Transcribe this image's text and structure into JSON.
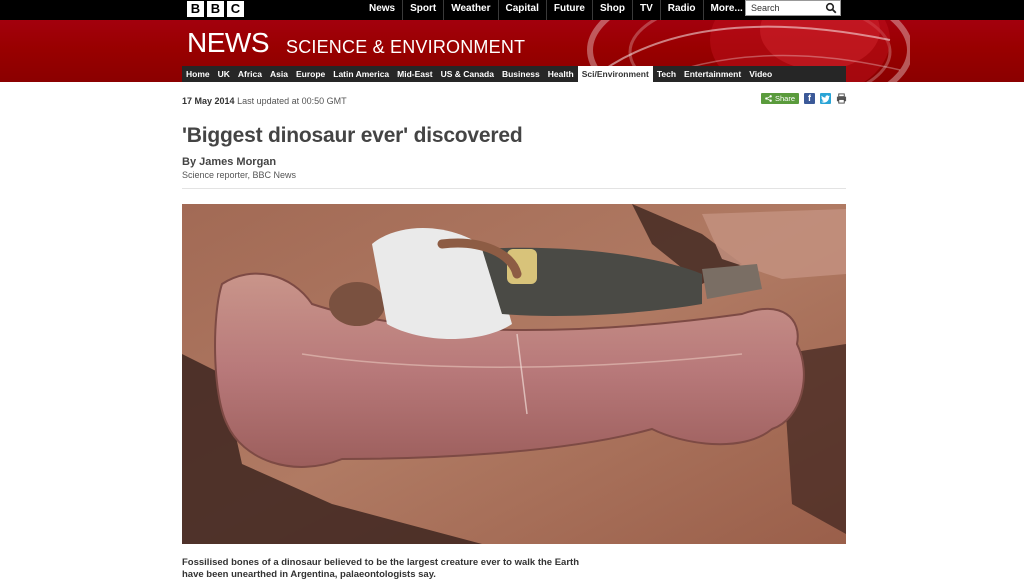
{
  "brand": {
    "logo_letters": [
      "B",
      "B",
      "C"
    ]
  },
  "top_nav": {
    "items": [
      "News",
      "Sport",
      "Weather",
      "Capital",
      "Future",
      "Shop",
      "TV",
      "Radio",
      "More..."
    ],
    "search_placeholder": "Search"
  },
  "banner": {
    "news_label": "NEWS",
    "section_label": "SCIENCE & ENVIRONMENT"
  },
  "section_nav": {
    "items": [
      "Home",
      "UK",
      "Africa",
      "Asia",
      "Europe",
      "Latin America",
      "Mid-East",
      "US & Canada",
      "Business",
      "Health",
      "Sci/Environment",
      "Tech",
      "Entertainment",
      "Video"
    ],
    "active": "Sci/Environment"
  },
  "article": {
    "date": "17 May 2014",
    "last_updated": "Last updated at 00:50 GMT",
    "share_label": "Share",
    "headline": "'Biggest dinosaur ever' discovered",
    "byline": "By James Morgan",
    "role": "Science reporter, BBC News",
    "caption_line1": "Fossilised bones of a dinosaur believed to be the largest creature ever to walk the Earth",
    "caption_line2": "have been unearthed in Argentina, palaeontologists say."
  },
  "colors": {
    "brand_red": "#990000",
    "nav_black": "#000000",
    "section_nav_bg": "#262626",
    "share_green": "#5a9b3c",
    "facebook_blue": "#3b5998",
    "twitter_blue": "#2aa4d6"
  },
  "icons": [
    "search-icon",
    "share-icon",
    "facebook-icon",
    "twitter-icon",
    "print-icon"
  ]
}
